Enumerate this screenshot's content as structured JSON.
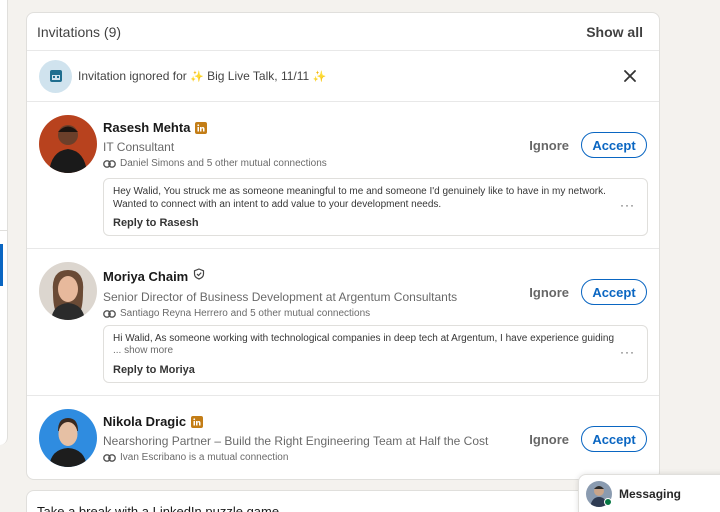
{
  "invitations": {
    "title": "Invitations (9)",
    "show_all": "Show all"
  },
  "notice": {
    "prefix": "Invitation ignored for",
    "event_name": "Big Live Talk, 11/11",
    "sparkle": "✨",
    "close_icon": "close-icon"
  },
  "items": [
    {
      "name": "Rasesh Mehta",
      "badge": "in",
      "headline": "IT Consultant",
      "mutual": "Daniel Simons and 5 other mutual connections",
      "ignore": "Ignore",
      "accept": "Accept",
      "message": "Hey Walid, You struck me as someone meaningful to me and someone I'd genuinely like to have in my network. Wanted to connect with an intent to add value to your development needs.",
      "reply": "Reply to Rasesh",
      "more": "···"
    },
    {
      "name": "Moriya Chaim",
      "badge": "verified-shield-icon",
      "headline": "Senior Director of Business Development at Argentum Consultants",
      "mutual": "Santiago Reyna Herrero and 5 other mutual connections",
      "ignore": "Ignore",
      "accept": "Accept",
      "message": "Hi Walid, As someone working with technological companies in deep tech at Argentum, I have experience guiding",
      "show_more": "... show more",
      "reply": "Reply to Moriya",
      "more": "···"
    },
    {
      "name": "Nikola Dragic",
      "badge": "in",
      "headline": "Nearshoring Partner – Build the Right Engineering Team at Half the Cost",
      "mutual": "Ivan Escribano is a mutual connection",
      "ignore": "Ignore",
      "accept": "Accept"
    }
  ],
  "puzzle": {
    "text": "Take a break with a LinkedIn puzzle game"
  },
  "messaging": {
    "label": "Messaging"
  },
  "colors": {
    "accent": "#0a66c2",
    "background": "#f4f2ee",
    "badge_gold": "#c37d16",
    "online": "#057642"
  }
}
